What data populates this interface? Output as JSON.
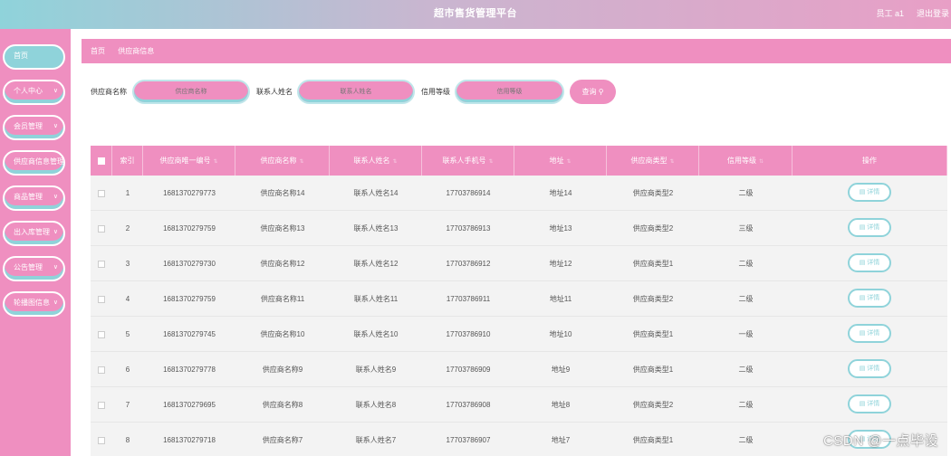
{
  "header": {
    "title": "超市售货管理平台",
    "user": "员工 a1",
    "logout": "退出登录"
  },
  "sidebar": {
    "items": [
      {
        "label": "首页",
        "has_chevron": false
      },
      {
        "label": "个人中心",
        "has_chevron": true
      },
      {
        "label": "会员管理",
        "has_chevron": true
      },
      {
        "label": "供应商信息管理",
        "has_chevron": false
      },
      {
        "label": "商品管理",
        "has_chevron": true
      },
      {
        "label": "出入库管理",
        "has_chevron": true
      },
      {
        "label": "公告管理",
        "has_chevron": true
      },
      {
        "label": "轮播图信息",
        "has_chevron": true
      }
    ]
  },
  "breadcrumb": {
    "home": "首页",
    "current": "供应商信息"
  },
  "search": {
    "supplier_name_label": "供应商名称",
    "supplier_name_placeholder": "供应商名称",
    "contact_name_label": "联系人姓名",
    "contact_name_placeholder": "联系人姓名",
    "credit_label": "信用等级",
    "credit_placeholder": "信用等级",
    "button": "查询"
  },
  "icons": {
    "chevron": "chevron-down-icon",
    "search": "search-icon",
    "detail": "document-icon",
    "sort": "sort-icon"
  },
  "colors": {
    "pink": "#ef8fc0",
    "teal": "#8fd3da",
    "white": "#ffffff"
  },
  "table": {
    "columns": [
      "索引",
      "供应商唯一编号",
      "供应商名称",
      "联系人姓名",
      "联系人手机号",
      "地址",
      "供应商类型",
      "信用等级",
      "操作"
    ],
    "action_label": "详情",
    "rows": [
      {
        "index": "1",
        "code": "1681370279773",
        "name": "供应商名称14",
        "contact": "联系人姓名14",
        "phone": "17703786914",
        "address": "地址14",
        "type": "供应商类型2",
        "credit": "二级"
      },
      {
        "index": "2",
        "code": "1681370279759",
        "name": "供应商名称13",
        "contact": "联系人姓名13",
        "phone": "17703786913",
        "address": "地址13",
        "type": "供应商类型2",
        "credit": "三级"
      },
      {
        "index": "3",
        "code": "1681370279730",
        "name": "供应商名称12",
        "contact": "联系人姓名12",
        "phone": "17703786912",
        "address": "地址12",
        "type": "供应商类型1",
        "credit": "二级"
      },
      {
        "index": "4",
        "code": "1681370279759",
        "name": "供应商名称11",
        "contact": "联系人姓名11",
        "phone": "17703786911",
        "address": "地址11",
        "type": "供应商类型2",
        "credit": "二级"
      },
      {
        "index": "5",
        "code": "1681370279745",
        "name": "供应商名称10",
        "contact": "联系人姓名10",
        "phone": "17703786910",
        "address": "地址10",
        "type": "供应商类型1",
        "credit": "一级"
      },
      {
        "index": "6",
        "code": "1681370279778",
        "name": "供应商名称9",
        "contact": "联系人姓名9",
        "phone": "17703786909",
        "address": "地址9",
        "type": "供应商类型1",
        "credit": "二级"
      },
      {
        "index": "7",
        "code": "1681370279695",
        "name": "供应商名称8",
        "contact": "联系人姓名8",
        "phone": "17703786908",
        "address": "地址8",
        "type": "供应商类型2",
        "credit": "二级"
      },
      {
        "index": "8",
        "code": "1681370279718",
        "name": "供应商名称7",
        "contact": "联系人姓名7",
        "phone": "17703786907",
        "address": "地址7",
        "type": "供应商类型1",
        "credit": "二级"
      }
    ]
  },
  "watermark": "CSDN @一点毕设"
}
